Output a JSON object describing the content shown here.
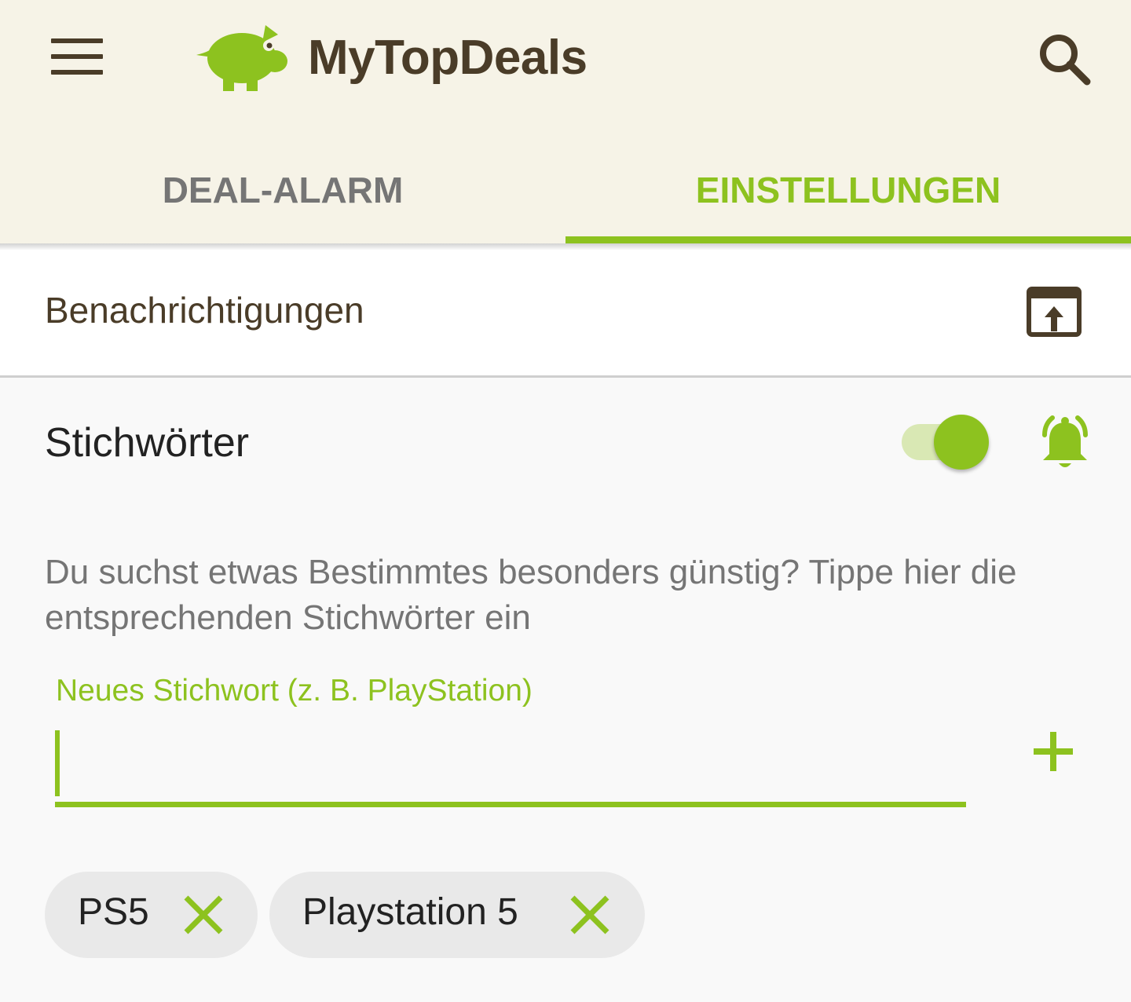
{
  "app": {
    "title": "MyTopDeals",
    "logo_icon": "piggy-bank-icon",
    "menu_icon": "hamburger-menu-icon",
    "search_icon": "search-icon"
  },
  "tabs": [
    {
      "label": "DEAL-ALARM",
      "active": false
    },
    {
      "label": "EINSTELLUNGEN",
      "active": true
    }
  ],
  "notifications": {
    "label": "Benachrichtigungen",
    "icon": "open-in-browser-icon"
  },
  "keywords": {
    "title": "Stichwörter",
    "toggle_on": true,
    "bell_icon": "bell-ringing-icon",
    "description": "Du suchst etwas Bestimmtes besonders günstig? Tippe hier die entsprechenden Stichwörter ein",
    "input_label": "Neues Stichwort (z. B. PlayStation)",
    "input_value": "",
    "add_icon": "plus-icon",
    "chips": [
      {
        "label": "PS5",
        "remove_icon": "close-icon"
      },
      {
        "label": "Playstation 5",
        "remove_icon": "close-icon"
      }
    ]
  },
  "colors": {
    "accent": "#8dc21f",
    "brand_dark": "#4a3c28",
    "appbar_bg": "#f6f3e7"
  }
}
